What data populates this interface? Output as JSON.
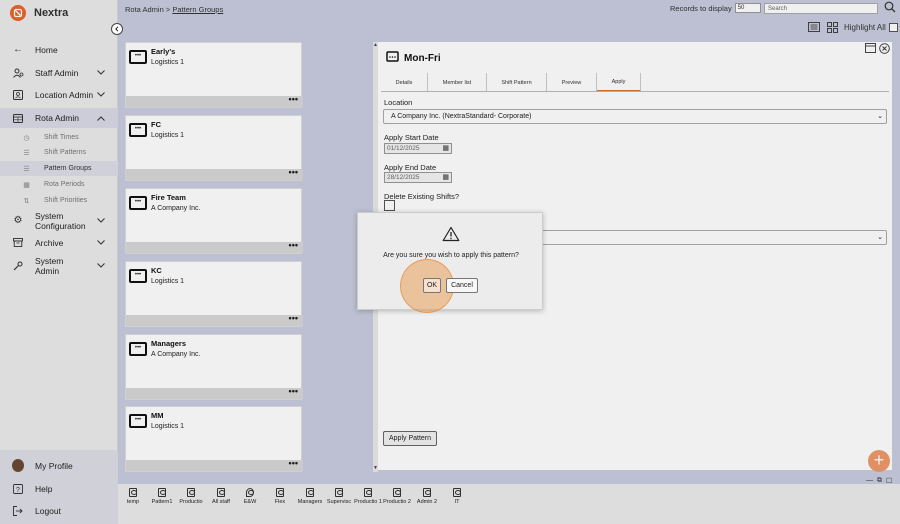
{
  "app": {
    "name": "Nextra"
  },
  "breadcrumb": {
    "parent": "Rota Admin",
    "separator": ">",
    "current": "Pattern Groups"
  },
  "records": {
    "label": "Records to display",
    "value": "50"
  },
  "search": {
    "placeholder": "Search"
  },
  "highlight_all": {
    "label": "Highlight All"
  },
  "sidebar": {
    "home": "Home",
    "staff_admin": "Staff Admin",
    "location_admin": "Location Admin",
    "rota_admin": "Rota Admin",
    "sub_items": [
      "Shift Times",
      "Shift Patterns",
      "Pattern Groups",
      "Rota Periods",
      "Shift Priorities"
    ],
    "system_configuration": "System Configuration",
    "archive": "Archive",
    "system_admin": "System Admin",
    "my_profile": "My Profile",
    "help": "Help",
    "logout": "Logout"
  },
  "cards": [
    {
      "title": "Early's",
      "subtitle": "Logistics 1"
    },
    {
      "title": "FC",
      "subtitle": "Logistics 1"
    },
    {
      "title": "Fire Team",
      "subtitle": "A Company Inc."
    },
    {
      "title": "KC",
      "subtitle": "Logistics 1"
    },
    {
      "title": "Managers",
      "subtitle": "A Company Inc."
    },
    {
      "title": "MM",
      "subtitle": "Logistics 1"
    }
  ],
  "card_more": "•••",
  "panel": {
    "title": "Mon-Fri",
    "tabs": [
      "Details",
      "Member list",
      "Shift Pattern",
      "Preview",
      "Apply"
    ],
    "location_label": "Location",
    "location_value": "A Company Inc. (NextraStandard- Corporate)",
    "start_label": "Apply Start Date",
    "start_value": "01/12/2025",
    "end_label": "Apply End Date",
    "end_value": "28/12/2025",
    "delete_label": "Delete Existing Shifts?",
    "apply_button": "Apply Pattern"
  },
  "modal": {
    "message": "Are you sure you wish to apply this pattern?",
    "ok": "OK",
    "cancel": "Cancel"
  },
  "fab": "+",
  "bottom_items": [
    "temp",
    "Pattern1",
    "Productio",
    "All staff",
    "E&W",
    "Flex",
    "Managers",
    "Supervisc",
    "Productio 1",
    "Productio 2",
    "Admin 2",
    "IT"
  ],
  "colors": {
    "accent": "#e8672a",
    "fab": "#ee9a6a",
    "active_tab": "#d4732a"
  }
}
